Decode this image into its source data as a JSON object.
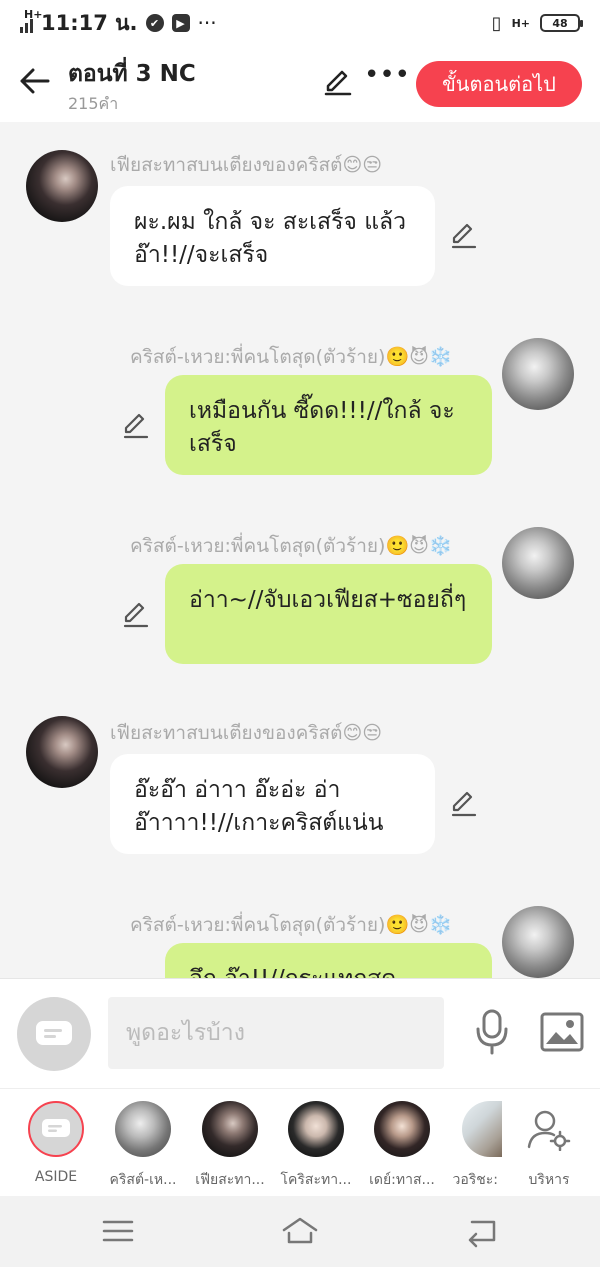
{
  "status_bar": {
    "network": "H+",
    "time": "11:17 น.",
    "battery": "48",
    "icons": [
      "signal-icon",
      "check-circle-icon",
      "youtube-icon",
      "overflow-dots-icon",
      "vibrate-icon",
      "battery-icon"
    ]
  },
  "header": {
    "title": "ตอนที่ 3 NC",
    "subtitle": "215คำ",
    "next_label": "ขั้นตอนต่อไป",
    "accent": "#f6424f"
  },
  "messages": [
    {
      "side": "left",
      "name": "เฟียสะทาสบนเตียงของคริสต์😊😒",
      "text": "ผะ.ผม ใกล้ จะ สะเสร็จ แล้ว อ๊า!!//จะเสร็จ"
    },
    {
      "side": "right",
      "name": "คริสต์-เหวย:พี่คนโตสุด(ตัวร้าย)🙂😈❄️",
      "text": "เหมือนกัน ซี๊ดด!!!//ใกล้ จะเสร็จ"
    },
    {
      "side": "right",
      "name": "คริสต์-เหวย:พี่คนโตสุด(ตัวร้าย)🙂😈❄️",
      "text": "อ่าา~//จับเอวเฟียส+ซอยถี่ๆ"
    },
    {
      "side": "left",
      "name": "เฟียสะทาสบนเตียงของคริสต์😊😒",
      "text": "อ๊ะอ๊า อ่าาา อ๊ะอ่ะ อ่า อ๊าาาา!!//เกาะคริสต์แน่น"
    },
    {
      "side": "right",
      "name": "คริสต์-เหวย:พี่คนโตสุด(ตัวร้าย)🙂😈❄️",
      "text": "อึก อ๊า!!//กระแทกสุด"
    }
  ],
  "input": {
    "placeholder": "พูดอะไรบ้าง"
  },
  "characters": [
    {
      "label": "ASIDE"
    },
    {
      "label": "คริสต์-เห..."
    },
    {
      "label": "เฟียสะทา..."
    },
    {
      "label": "โคริสะทา..."
    },
    {
      "label": "เดย์:ทาส..."
    },
    {
      "label": "วอริชะ:"
    },
    {
      "label": "บริหาร"
    }
  ],
  "colors": {
    "left_bubble": "#ffffff",
    "right_bubble": "#d4f28b",
    "background": "#f4f4f4"
  }
}
